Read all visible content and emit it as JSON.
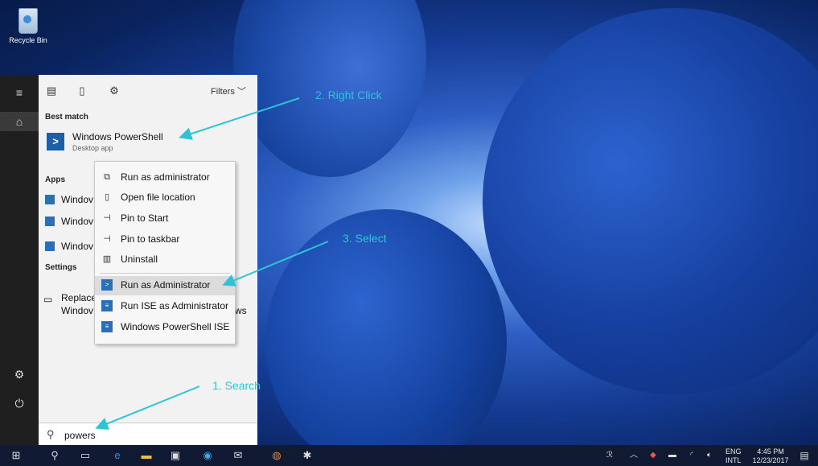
{
  "desktop": {
    "recycle_bin_label": "Recycle Bin"
  },
  "start_menu": {
    "filters_label": "Filters",
    "best_match_label": "Best match",
    "best_match": {
      "title": "Windows PowerShell",
      "subtitle": "Desktop app"
    },
    "apps_label": "Apps",
    "apps": [
      {
        "label": "Windov"
      },
      {
        "label": "Windov"
      },
      {
        "label": "Windov"
      }
    ],
    "settings_label": "Settings",
    "setting_item": {
      "line1": "Replace",
      "line2": "Windov",
      "tail": "ws"
    },
    "search_value": "powers"
  },
  "context_menu": {
    "items": [
      {
        "label": "Run as administrator",
        "icon": "run-as-admin-icon"
      },
      {
        "label": "Open file location",
        "icon": "file-location-icon"
      },
      {
        "label": "Pin to Start",
        "icon": "pin-icon"
      },
      {
        "label": "Pin to taskbar",
        "icon": "pin-icon"
      },
      {
        "label": "Uninstall",
        "icon": "trash-icon"
      },
      {
        "label": "Run as Administrator",
        "icon": "powershell-icon"
      },
      {
        "label": "Run ISE as Administrator",
        "icon": "powershell-ise-icon"
      },
      {
        "label": "Windows PowerShell ISE",
        "icon": "powershell-ise-icon"
      }
    ]
  },
  "annotations": {
    "step1": "1. Search",
    "step2": "2. Right Click",
    "step3": "3. Select",
    "color": "#2ec4d6"
  },
  "taskbar": {
    "language_top": "ENG",
    "language_bottom": "INTL",
    "time": "4:45 PM",
    "date": "12/23/2017"
  }
}
